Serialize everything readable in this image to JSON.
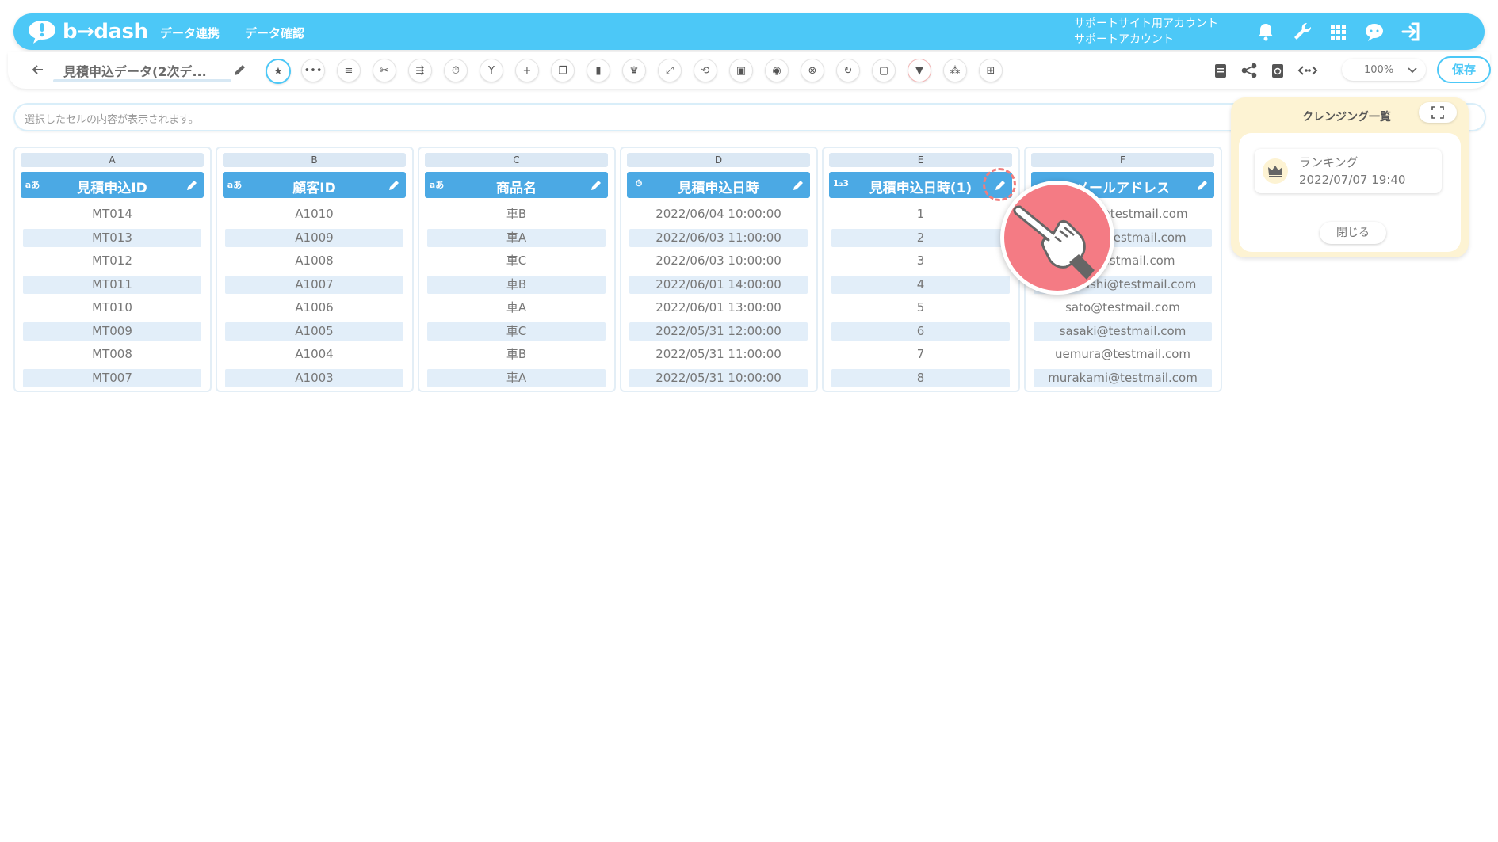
{
  "app": {
    "logo_text": "b→dash",
    "nav": [
      "データ連携",
      "データ確認"
    ],
    "account_line1": "サポートサイト用アカウント",
    "account_line2": "サポートアカウント",
    "nav_icons": [
      "bell-icon",
      "wrench-icon",
      "grid-apps-icon",
      "chat-icon",
      "logout-icon"
    ]
  },
  "toolbar": {
    "title": "見積申込データ(2次デ...",
    "zoom": "100%",
    "save_label": "保存",
    "tools": [
      "star-icon",
      "more-icon",
      "list-icon",
      "cut-icon",
      "merge-icon",
      "timer-icon",
      "branch-icon",
      "plus-icon",
      "copy-icon",
      "trash-icon",
      "crown-icon",
      "expand-icon",
      "repeat-icon",
      "lock-icon",
      "box-icon",
      "cancel-icon",
      "refresh-icon",
      "square-icon",
      "filter-icon",
      "tile-icon",
      "table-icon"
    ],
    "right_tools": [
      "clipboard-icon",
      "share-icon",
      "history-icon",
      "code-icon"
    ]
  },
  "cell_display": {
    "placeholder": "選択したセルの内容が表示されます。"
  },
  "columns": [
    {
      "letter": "A",
      "type": "aあ",
      "name": "見積申込ID",
      "cells": [
        "MT014",
        "MT013",
        "MT012",
        "MT011",
        "MT010",
        "MT009",
        "MT008",
        "MT007"
      ]
    },
    {
      "letter": "B",
      "type": "aあ",
      "name": "顧客ID",
      "cells": [
        "A1010",
        "A1009",
        "A1008",
        "A1007",
        "A1006",
        "A1005",
        "A1004",
        "A1003"
      ]
    },
    {
      "letter": "C",
      "type": "aあ",
      "name": "商品名",
      "cells": [
        "車B",
        "車A",
        "車C",
        "車B",
        "車A",
        "車C",
        "車B",
        "車A"
      ]
    },
    {
      "letter": "D",
      "type": "⏱",
      "name": "見積申込日時",
      "cells": [
        "2022/06/04 10:00:00",
        "2022/06/03 11:00:00",
        "2022/06/03 10:00:00",
        "2022/06/01 14:00:00",
        "2022/06/01 13:00:00",
        "2022/05/31 12:00:00",
        "2022/05/31 11:00:00",
        "2022/05/31 10:00:00"
      ]
    },
    {
      "letter": "E",
      "type": "1₂3",
      "name": "見積申込日時(1)",
      "cells": [
        "1",
        "2",
        "3",
        "4",
        "5",
        "6",
        "7",
        "8"
      ]
    },
    {
      "letter": "F",
      "type": "",
      "name": "メールアドレス",
      "cells": [
        "tanaka@testmail.com",
        "suzuki@testmail.com",
        "ito@testmail.com",
        "takahashi@testmail.com",
        "sato@testmail.com",
        "sasaki@testmail.com",
        "uemura@testmail.com",
        "murakami@testmail.com"
      ]
    }
  ],
  "cleansing": {
    "title": "クレンジング一覧",
    "item_name": "ランキング",
    "item_date": "2022/07/07 19:40",
    "close_label": "閉じる"
  },
  "colors": {
    "nav_bg": "#4cc8f7",
    "header_bg": "#4ba9e4",
    "alt_row": "#e2eef9",
    "panel_bg": "#fdf3d3",
    "pointer": "#f47b84"
  }
}
